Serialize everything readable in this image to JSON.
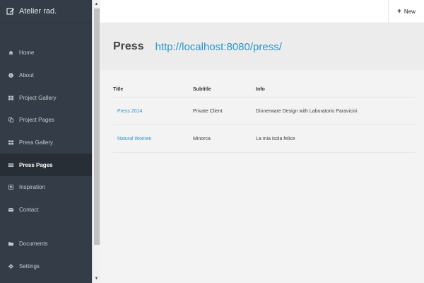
{
  "sidebar": {
    "brand": "Atelier rad.",
    "items": [
      {
        "label": "Home",
        "icon": "home-icon"
      },
      {
        "label": "About",
        "icon": "info-icon"
      },
      {
        "label": "Project Gallery",
        "icon": "grid-icon"
      },
      {
        "label": "Project Pages",
        "icon": "copy-icon"
      },
      {
        "label": "Press Gallery",
        "icon": "grid-icon"
      },
      {
        "label": "Press Pages",
        "icon": "newspaper-icon"
      },
      {
        "label": "Inspiration",
        "icon": "lightbulb-icon"
      },
      {
        "label": "Contact",
        "icon": "envelope-icon"
      }
    ],
    "bottom_items": [
      {
        "label": "Documents",
        "icon": "folder-icon"
      },
      {
        "label": "Settings",
        "icon": "gear-icon"
      }
    ],
    "active_item": "Press Pages"
  },
  "topbar": {
    "new_label": "New"
  },
  "header": {
    "title": "Press",
    "url": "http://localhost:8080/press/"
  },
  "table": {
    "columns": [
      "Title",
      "Subtitle",
      "Info"
    ],
    "rows": [
      {
        "title": "Press 2014",
        "subtitle": "Private Client",
        "info": "Dinnerware Design with Laboratorio Paravicini"
      },
      {
        "title": "Natural Women",
        "subtitle": "Minorca",
        "info": "La mia isola felice"
      }
    ]
  },
  "colors": {
    "sidebar_bg": "#343d47",
    "active_bg": "#272e36",
    "link": "#2a95cc"
  }
}
